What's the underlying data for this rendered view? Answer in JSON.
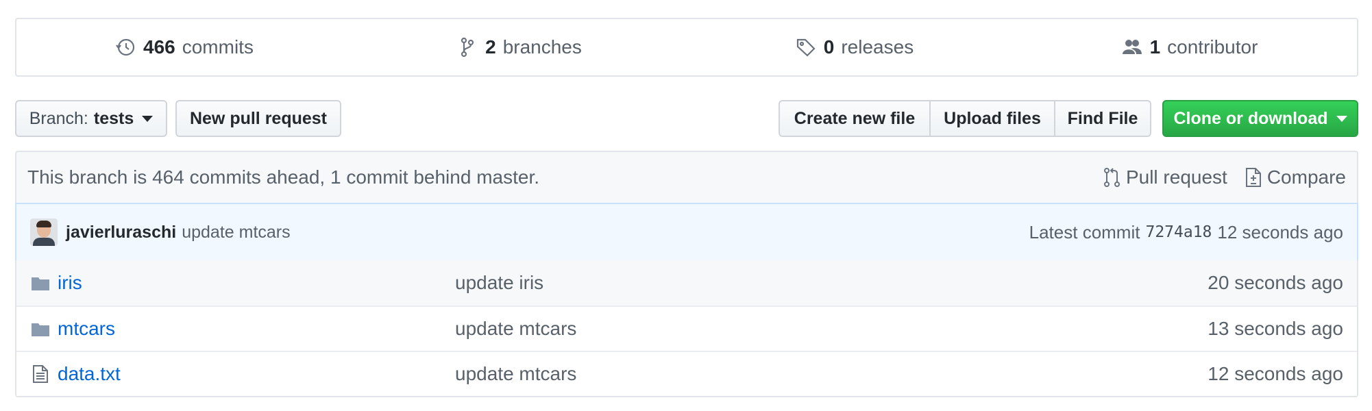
{
  "stats": {
    "commits": {
      "num": "466",
      "label": "commits",
      "icon": "history-icon"
    },
    "branches": {
      "num": "2",
      "label": "branches",
      "icon": "branch-icon"
    },
    "releases": {
      "num": "0",
      "label": "releases",
      "icon": "tag-icon"
    },
    "contributors": {
      "num": "1",
      "label": "contributor",
      "icon": "people-icon"
    }
  },
  "toolbar": {
    "branch_prefix": "Branch:",
    "branch_name": "tests",
    "new_pull_request": "New pull request",
    "create_new_file": "Create new file",
    "upload_files": "Upload files",
    "find_file": "Find File",
    "clone_or_download": "Clone or download"
  },
  "branch_info": {
    "message": "This branch is 464 commits ahead, 1 commit behind master.",
    "pull_request": "Pull request",
    "compare": "Compare"
  },
  "latest_commit": {
    "author": "javierluraschi",
    "message": "update mtcars",
    "label": "Latest commit",
    "sha": "7274a18",
    "time": "12 seconds ago"
  },
  "files": [
    {
      "type": "folder",
      "name": "iris",
      "message": "update iris",
      "age": "20 seconds ago"
    },
    {
      "type": "folder",
      "name": "mtcars",
      "message": "update mtcars",
      "age": "13 seconds ago"
    },
    {
      "type": "file",
      "name": "data.txt",
      "message": "update mtcars",
      "age": "12 seconds ago"
    }
  ],
  "colors": {
    "link": "#0366d6",
    "clone_button": "#28a745",
    "commit_bar_bg": "#f1f8ff"
  }
}
